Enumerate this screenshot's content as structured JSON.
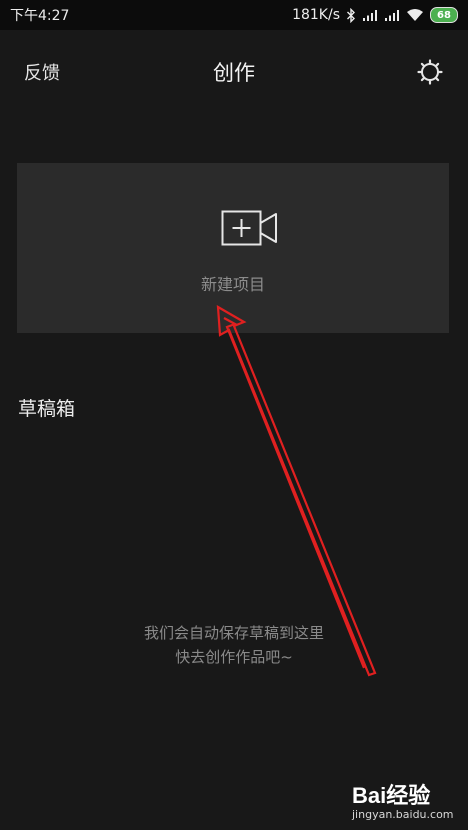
{
  "status_bar": {
    "time": "下午4:27",
    "network_speed": "181K/s",
    "battery_level": "68",
    "icons": [
      "bluetooth-icon",
      "signal-icon",
      "signal-icon",
      "wifi-icon",
      "battery-icon"
    ]
  },
  "header": {
    "feedback_label": "反馈",
    "title": "创作",
    "settings_icon": "gear-icon"
  },
  "new_project": {
    "label": "新建项目",
    "icon": "video-add-icon"
  },
  "drafts": {
    "title": "草稿箱",
    "empty_line1": "我们会自动保存草稿到这里",
    "empty_line2": "快去创作作品吧~"
  },
  "annotation": {
    "color": "#e02020"
  },
  "watermark": {
    "brand": "Bai经验",
    "site": "jingyan.baidu.com"
  },
  "colors": {
    "background": "#181818",
    "card": "#2b2b2b",
    "battery": "#4cb050"
  }
}
